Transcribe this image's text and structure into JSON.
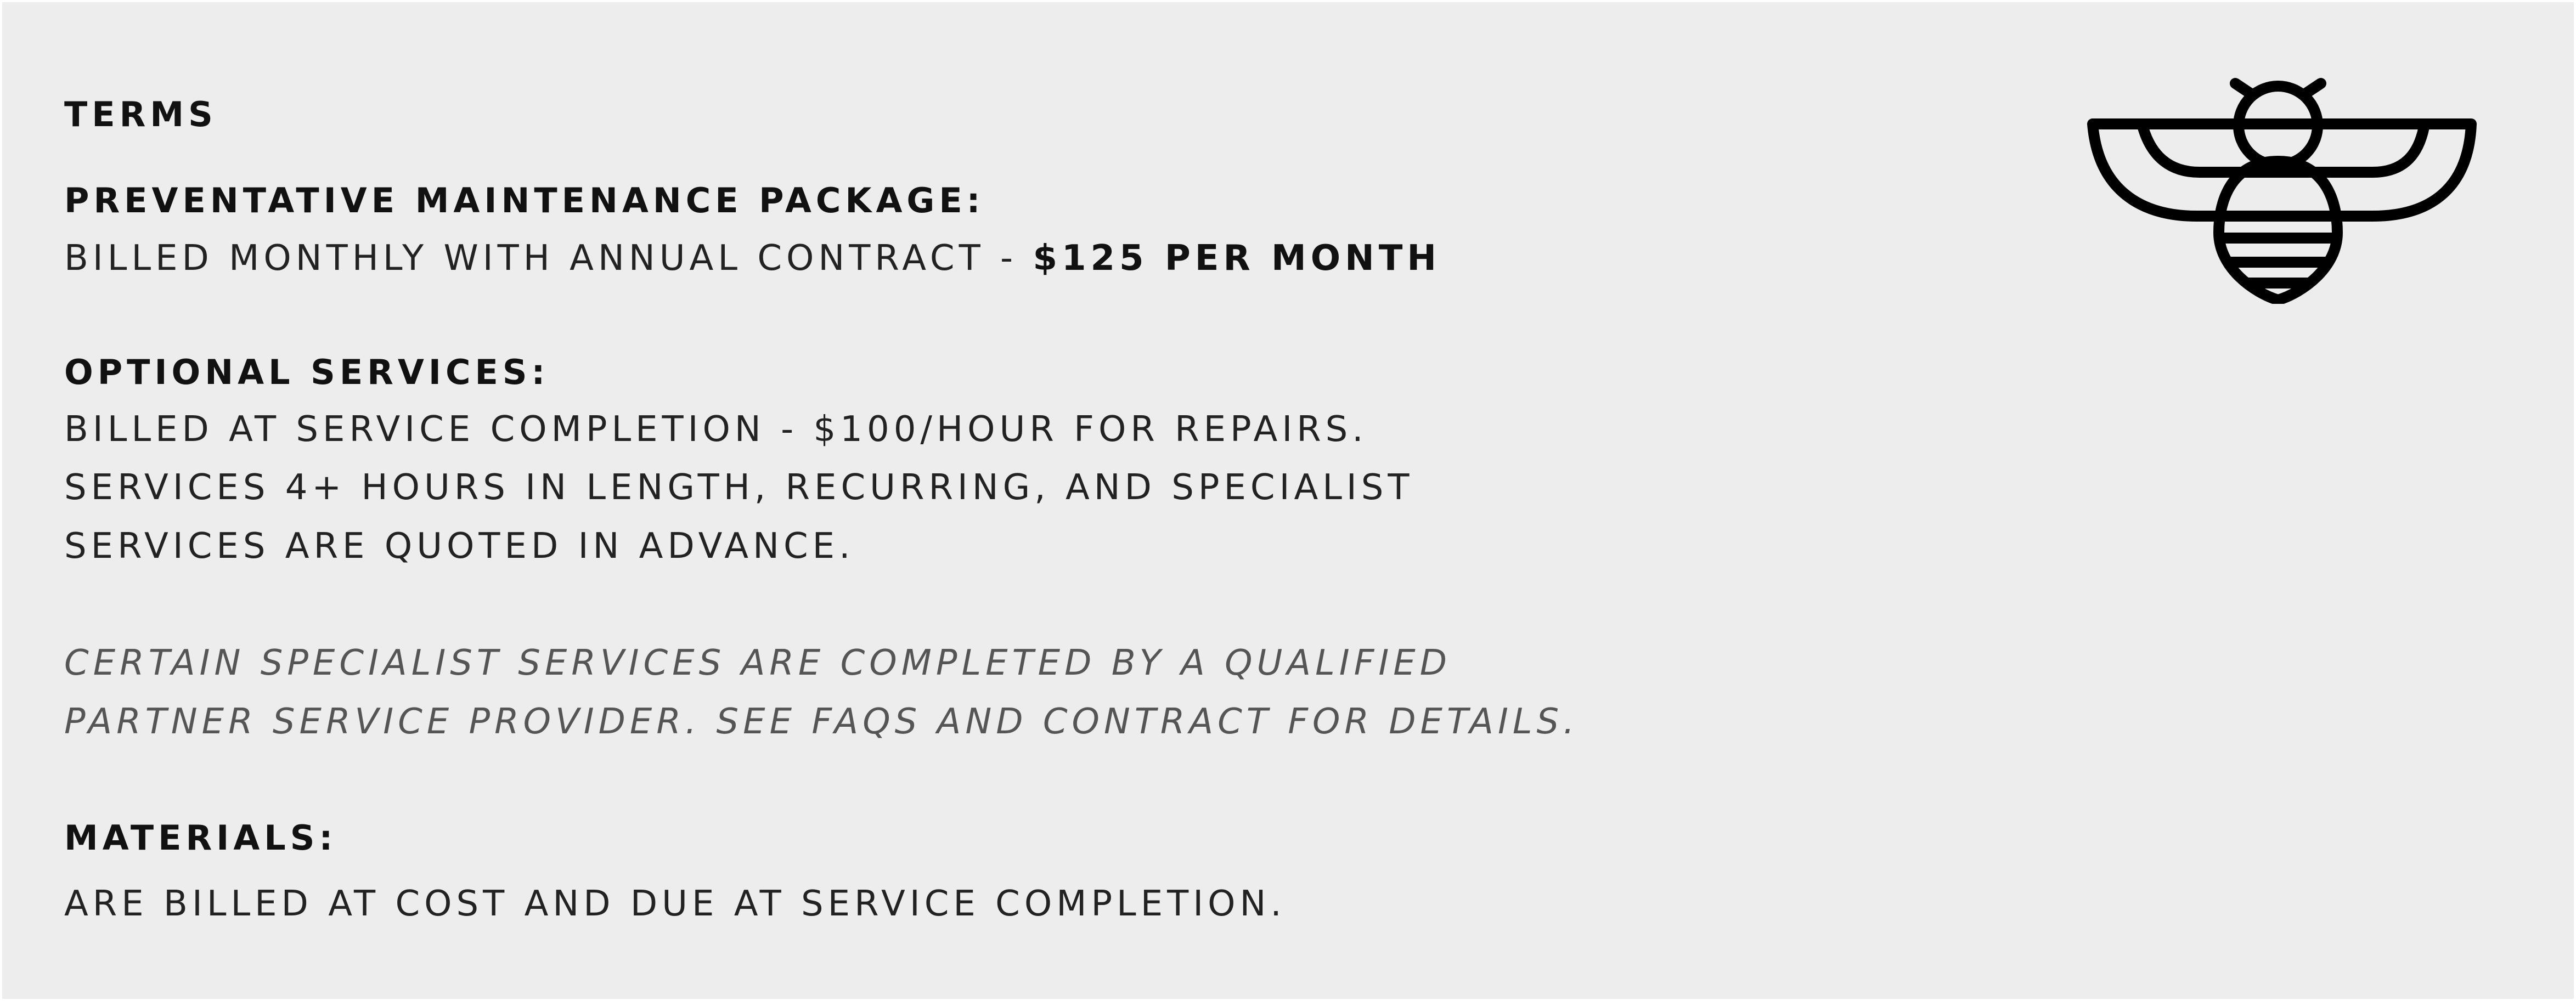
{
  "terms_heading": "TERMS",
  "preventative": {
    "heading": "PREVENTATIVE MAINTENANCE PACKAGE:",
    "billing_text": "BILLED MONTHLY WITH ANNUAL CONTRACT - ",
    "price": "$125 PER MONTH"
  },
  "optional": {
    "heading": "OPTIONAL SERVICES:",
    "lines": [
      "BILLED AT SERVICE COMPLETION - $100/HOUR FOR REPAIRS.",
      "SERVICES 4+ HOURS IN LENGTH, RECURRING, AND SPECIALIST",
      "SERVICES ARE QUOTED IN ADVANCE."
    ]
  },
  "note": {
    "lines": [
      "CERTAIN SPECIALIST SERVICES ARE COMPLETED BY A QUALIFIED",
      "PARTNER SERVICE PROVIDER. SEE FAQS AND CONTRACT FOR DETAILS."
    ]
  },
  "materials": {
    "heading": "MATERIALS:",
    "text": "ARE BILLED AT COST AND DUE AT SERVICE COMPLETION."
  },
  "logo": {
    "icon": "bee-icon",
    "color": "#000000"
  },
  "colors": {
    "background": "#ededed",
    "text": "#1a1a1a",
    "note_text": "#555555"
  }
}
